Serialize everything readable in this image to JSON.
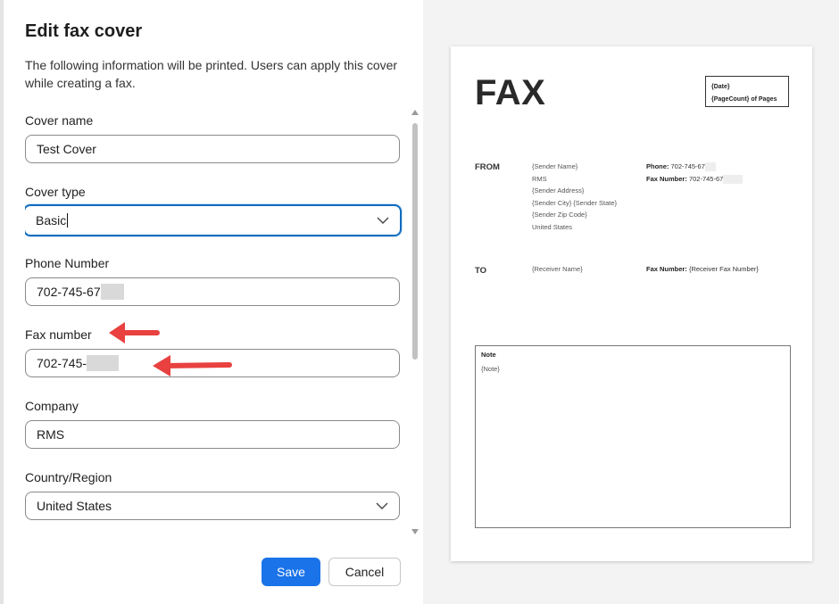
{
  "dialog": {
    "title": "Edit fax cover",
    "description": "The following information will be printed. Users can apply this cover while creating a fax."
  },
  "form": {
    "cover_name": {
      "label": "Cover name",
      "value": "Test Cover"
    },
    "cover_type": {
      "label": "Cover type",
      "value": "Basic"
    },
    "phone": {
      "label": "Phone Number",
      "value": "702-745-67"
    },
    "fax": {
      "label": "Fax number",
      "value": "702-745-"
    },
    "company": {
      "label": "Company",
      "value": "RMS"
    },
    "country": {
      "label": "Country/Region",
      "value": "United States"
    }
  },
  "buttons": {
    "save": "Save",
    "cancel": "Cancel"
  },
  "preview": {
    "fax_title": "FAX",
    "date": "{Date}",
    "page_count": "{PageCount} of Pages",
    "from_label": "FROM",
    "from_lines": [
      "{Sender Name}",
      "RMS",
      "{Sender Address}",
      "{Sender City} {Sender State}",
      "{Sender Zip Code}",
      "United States"
    ],
    "phone_label": "Phone:",
    "phone_value": "702-745-67",
    "fax_label": "Fax Number:",
    "fax_value": "702-745-67",
    "to_label": "TO",
    "to_name": "{Receiver Name}",
    "to_fax_label": "Fax Number:",
    "to_fax_value": "{Receiver Fax Number}",
    "note_title": "Note",
    "note_value": "{Note}"
  },
  "colors": {
    "primary": "#1a73e8",
    "focus": "#0f6cbd",
    "annotation_arrow": "#e8413f"
  }
}
